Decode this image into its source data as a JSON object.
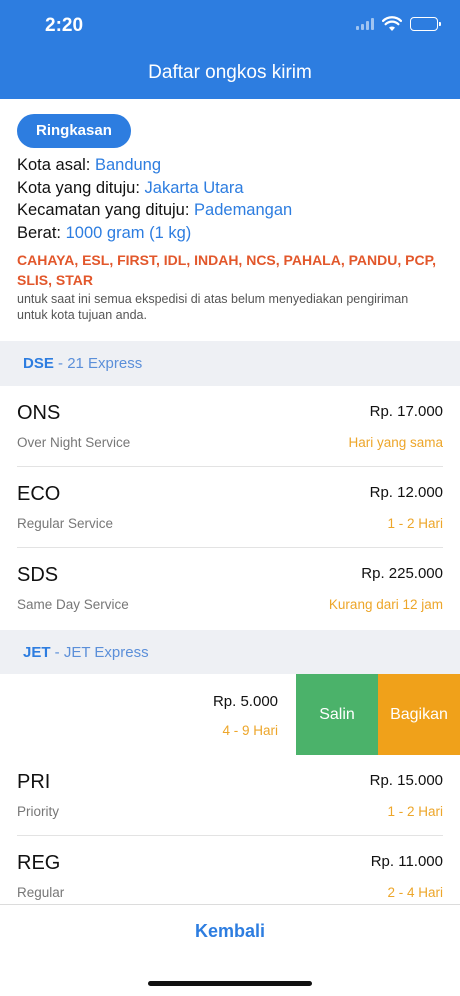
{
  "status_bar": {
    "time": "2:20"
  },
  "header": {
    "title": "Daftar ongkos kirim"
  },
  "summary": {
    "button_label": "Ringkasan",
    "origin_label": "Kota asal: ",
    "origin_value": "Bandung",
    "destination_label": "Kota yang dituju: ",
    "destination_value": "Jakarta Utara",
    "district_label": "Kecamatan yang dituju: ",
    "district_value": "Pademangan",
    "weight_label": "Berat: ",
    "weight_value": "1000 gram (1 kg)",
    "unavailable_couriers": "CAHAYA, ESL, FIRST, IDL, INDAH, NCS, PAHALA, PANDU, PCP, SLIS, STAR",
    "unavailable_note": "untuk saat ini semua ekspedisi di atas belum menyediakan pengiriman untuk kota tujuan anda."
  },
  "sections": [
    {
      "code": "DSE",
      "separator": " - ",
      "name": "21 Express",
      "services": [
        {
          "name": "ONS",
          "description": "Over Night Service",
          "price": "Rp. 17.000",
          "eta": "Hari yang sama"
        },
        {
          "name": "ECO",
          "description": "Regular Service",
          "price": "Rp. 12.000",
          "eta": "1 - 2  Hari"
        },
        {
          "name": "SDS",
          "description": "Same Day Service",
          "price": "Rp. 225.000",
          "eta": "Kurang dari 12 jam"
        }
      ]
    },
    {
      "code": "JET",
      "separator": " - ",
      "name": "JET Express",
      "swiped_service": {
        "price": "Rp. 5.000",
        "eta": "4 - 9  Hari",
        "copy_label": "Salin",
        "share_label": "Bagikan"
      },
      "services": [
        {
          "name": "PRI",
          "description": "Priority",
          "price": "Rp. 15.000",
          "eta": "1 - 2  Hari"
        },
        {
          "name": "REG",
          "description": "Regular",
          "price": "Rp. 11.000",
          "eta": "2 - 4  Hari"
        }
      ]
    }
  ],
  "footer": {
    "back_label": "Kembali"
  },
  "colors": {
    "primary": "#2d7de0",
    "courier_warning": "#e2572b",
    "eta": "#eda62a",
    "copy": "#4bb26a",
    "share": "#f0a11a"
  }
}
